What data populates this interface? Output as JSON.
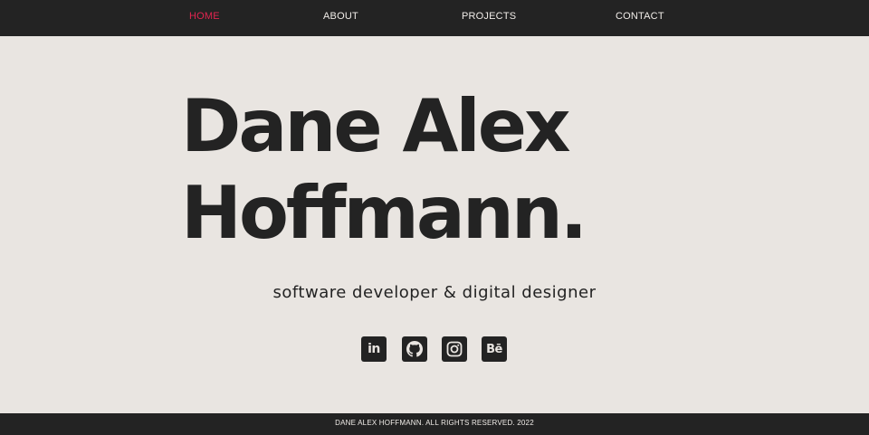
{
  "nav": {
    "items": [
      {
        "label": "HOME",
        "active": true
      },
      {
        "label": "ABOUT",
        "active": false
      },
      {
        "label": "PROJECTS",
        "active": false
      },
      {
        "label": "CONTACT",
        "active": false
      }
    ]
  },
  "hero": {
    "name_line_1": "Dane Alex",
    "name_line_2": "Hoffmann.",
    "tagline": "software developer & digital designer"
  },
  "social": {
    "items": [
      {
        "icon": "linkedin-icon",
        "glyph": "in"
      },
      {
        "icon": "github-icon"
      },
      {
        "icon": "instagram-icon"
      },
      {
        "icon": "behance-icon",
        "glyph": "Bē"
      }
    ]
  },
  "footer": {
    "text": "DANE ALEX HOFFMANN. ALL RIGHTS RESERVED. 2022"
  },
  "colors": {
    "background": "#e9e5e1",
    "dark": "#232323",
    "accent": "#e0244f",
    "nav_text": "#f0ece8"
  }
}
